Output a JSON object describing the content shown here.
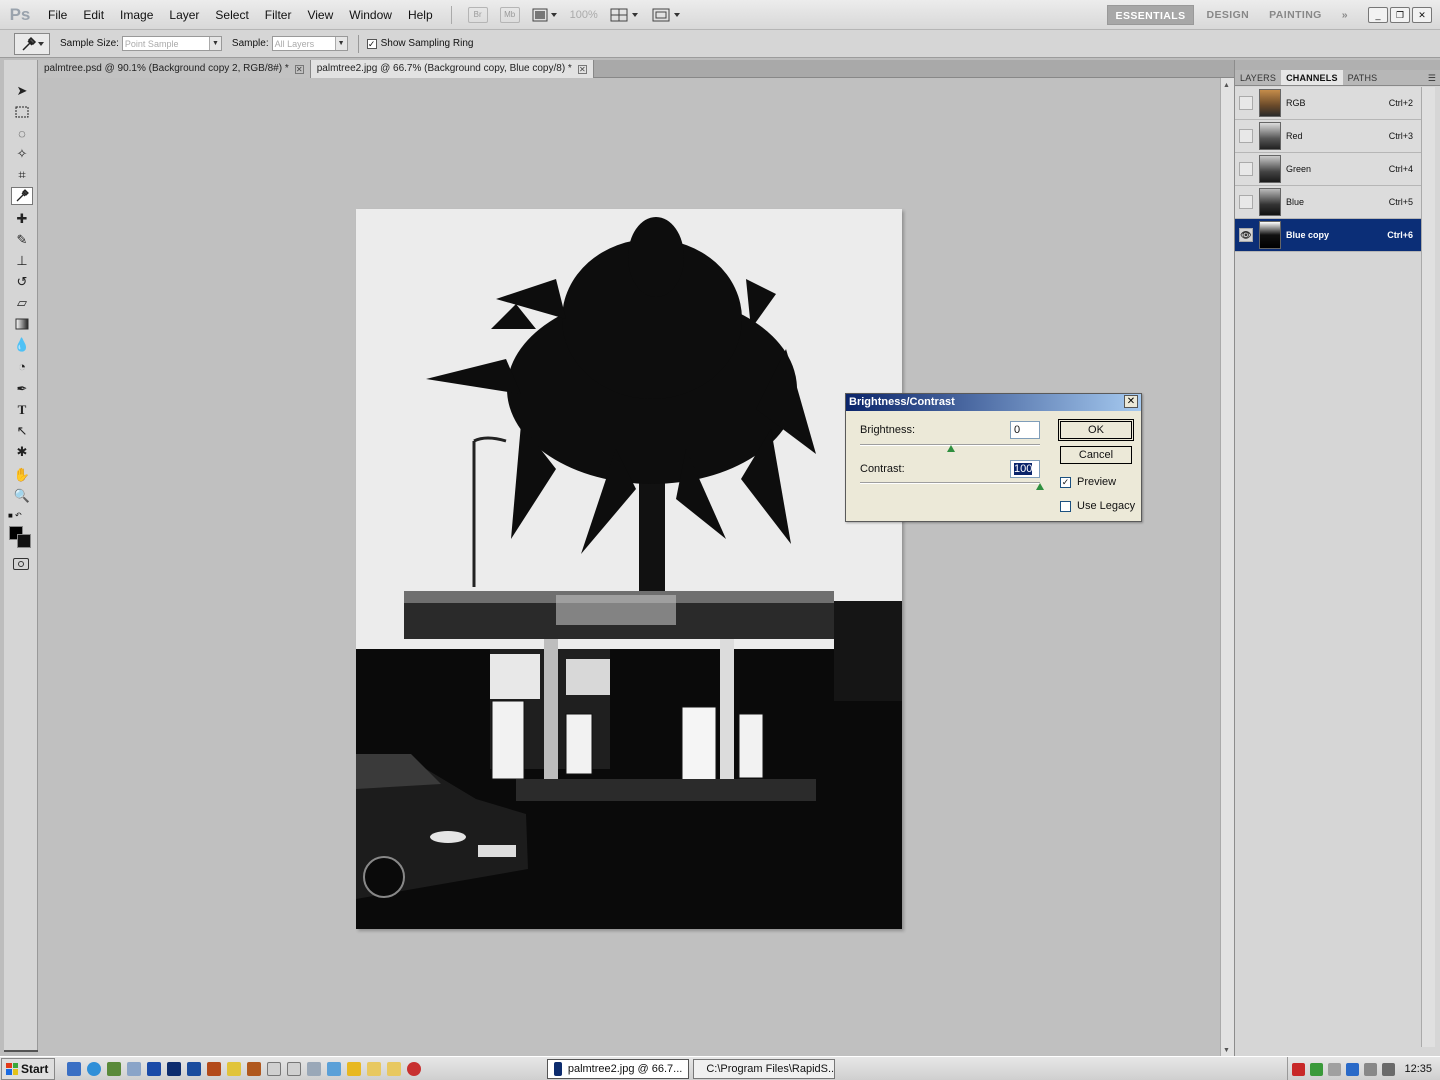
{
  "app": {
    "logo": "Ps"
  },
  "menu": [
    "File",
    "Edit",
    "Image",
    "Layer",
    "Select",
    "Filter",
    "View",
    "Window",
    "Help"
  ],
  "menubar_tools": {
    "bridge": "Br",
    "minibridge": "Mb",
    "zoom": "100%"
  },
  "workspaces": {
    "essentials": "ESSENTIALS",
    "design": "DESIGN",
    "painting": "PAINTING",
    "more": "»"
  },
  "options": {
    "sample_size_label": "Sample Size:",
    "sample_size_value": "Point Sample",
    "sample_label": "Sample:",
    "sample_value": "All Layers",
    "show_ring_label": "Show Sampling Ring",
    "show_ring_checked": "✓"
  },
  "tabs": [
    {
      "label": "palmtree.psd @ 90.1% (Background copy 2, RGB/8#) *",
      "close": "✕"
    },
    {
      "label": "palmtree2.jpg @ 66.7% (Background copy, Blue copy/8) *",
      "close": "✕"
    }
  ],
  "panel": {
    "tabs": [
      "LAYERS",
      "CHANNELS",
      "PATHS"
    ],
    "channels": [
      {
        "name": "RGB",
        "shortcut": "Ctrl+2"
      },
      {
        "name": "Red",
        "shortcut": "Ctrl+3"
      },
      {
        "name": "Green",
        "shortcut": "Ctrl+4"
      },
      {
        "name": "Blue",
        "shortcut": "Ctrl+5"
      },
      {
        "name": "Blue copy",
        "shortcut": "Ctrl+6"
      }
    ]
  },
  "dialog": {
    "title": "Brightness/Contrast",
    "close": "✕",
    "brightness_label": "Brightness:",
    "brightness_value": "0",
    "contrast_label": "Contrast:",
    "contrast_value": "100",
    "ok_label": "OK",
    "cancel_label": "Cancel",
    "preview_label": "Preview",
    "preview_checked": "✓",
    "legacy_label": "Use Legacy"
  },
  "taskbar": {
    "start": "Start",
    "tasks": [
      "palmtree2.jpg @ 66.7...",
      "C:\\Program Files\\RapidS..."
    ],
    "clock": "12:35"
  },
  "colors": {
    "selection_blue": "#0b2e77",
    "canvas_bg": "#c0c0c0",
    "title_bar": "#0a246a"
  }
}
